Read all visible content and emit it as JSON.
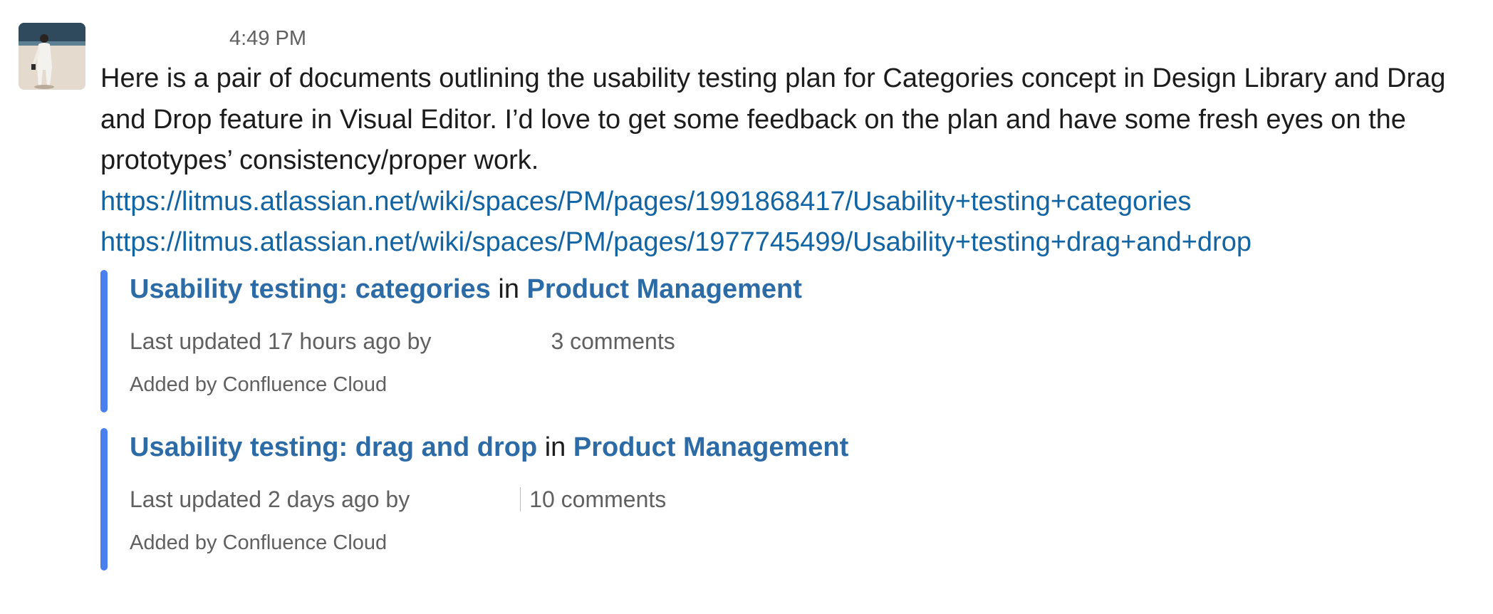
{
  "message": {
    "timestamp": "4:49 PM",
    "text": "Here is a pair of documents outlining the usability testing plan for Categories concept in Design Library and Drag and Drop feature in Visual Editor. I’d love to get some feedback on the plan and have some fresh eyes on the prototypes’ consistency/proper work.",
    "links": [
      "https://litmus.atlassian.net/wiki/spaces/PM/pages/1991868417/Usability+testing+categories",
      "https://litmus.atlassian.net/wiki/spaces/PM/pages/1977745499/Usability+testing+drag+and+drop"
    ]
  },
  "unfurls": [
    {
      "title": "Usability testing: categories",
      "in": "in",
      "space": "Product Management",
      "updated": "Last updated 17 hours ago by",
      "comments": "3 comments",
      "footer": "Added by Confluence Cloud"
    },
    {
      "title": "Usability testing: drag and drop",
      "in": "in",
      "space": "Product Management",
      "updated": "Last updated 2 days ago by",
      "comments": "10 comments",
      "footer": "Added by Confluence Cloud"
    }
  ],
  "colors": {
    "link": "#1264a3",
    "attachment_bar": "#4a7ff0",
    "muted_text": "#616061"
  },
  "icons": {
    "avatar": "user-avatar-photo"
  }
}
